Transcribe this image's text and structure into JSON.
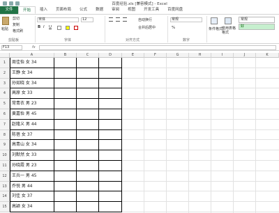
{
  "window": {
    "title": "百度经验.xls [兼容模式] - Excel"
  },
  "tabs": [
    "文件",
    "开始",
    "插入",
    "页面布局",
    "公式",
    "数据",
    "审阅",
    "视图",
    "开发工具",
    "百度网盘"
  ],
  "ribbon": {
    "paste_label": "粘贴",
    "cut_label": "剪切",
    "copy_label": "复制",
    "format_painter_label": "格式刷",
    "clipboard_group": "剪贴板",
    "font_name": "宋体",
    "font_size": "12",
    "font_group": "字体",
    "bold": "B",
    "italic": "I",
    "underline": "U",
    "wrap_text": "自动换行",
    "merge_center": "合并后居中",
    "align_group": "对齐方式",
    "number_format": "常规",
    "number_group": "数字",
    "cond_format": "条件格式",
    "table_format": "套用表格格式",
    "style_normal": "常规",
    "style_good": "好"
  },
  "formula_bar": {
    "name_box": "F13",
    "fx": "fx",
    "content": ""
  },
  "columns": [
    "A",
    "B",
    "C",
    "D",
    "E",
    "F",
    "G",
    "H",
    "I",
    "J",
    "K"
  ],
  "rows": [
    {
      "num": "1",
      "a": "周佳怡 女 34"
    },
    {
      "num": "2",
      "a": "王静 女 34"
    },
    {
      "num": "3",
      "a": "孙如晓 女 34"
    },
    {
      "num": "4",
      "a": "高原 女 33"
    },
    {
      "num": "5",
      "a": "常青衣 男 23"
    },
    {
      "num": "6",
      "a": "黄嘉怡 男 45"
    },
    {
      "num": "7",
      "a": "赵隆义 男 44"
    },
    {
      "num": "8",
      "a": "陈蓓 女 37"
    },
    {
      "num": "9",
      "a": "高青山 女 34"
    },
    {
      "num": "10",
      "a": "刘默然 女 33"
    },
    {
      "num": "11",
      "a": "孙晓霞 男 23"
    },
    {
      "num": "12",
      "a": "王兵一 男 45"
    },
    {
      "num": "13",
      "a": "乔悦 男 44"
    },
    {
      "num": "14",
      "a": "刘佳 女 37"
    },
    {
      "num": "15",
      "a": "高颖 女 34"
    }
  ]
}
